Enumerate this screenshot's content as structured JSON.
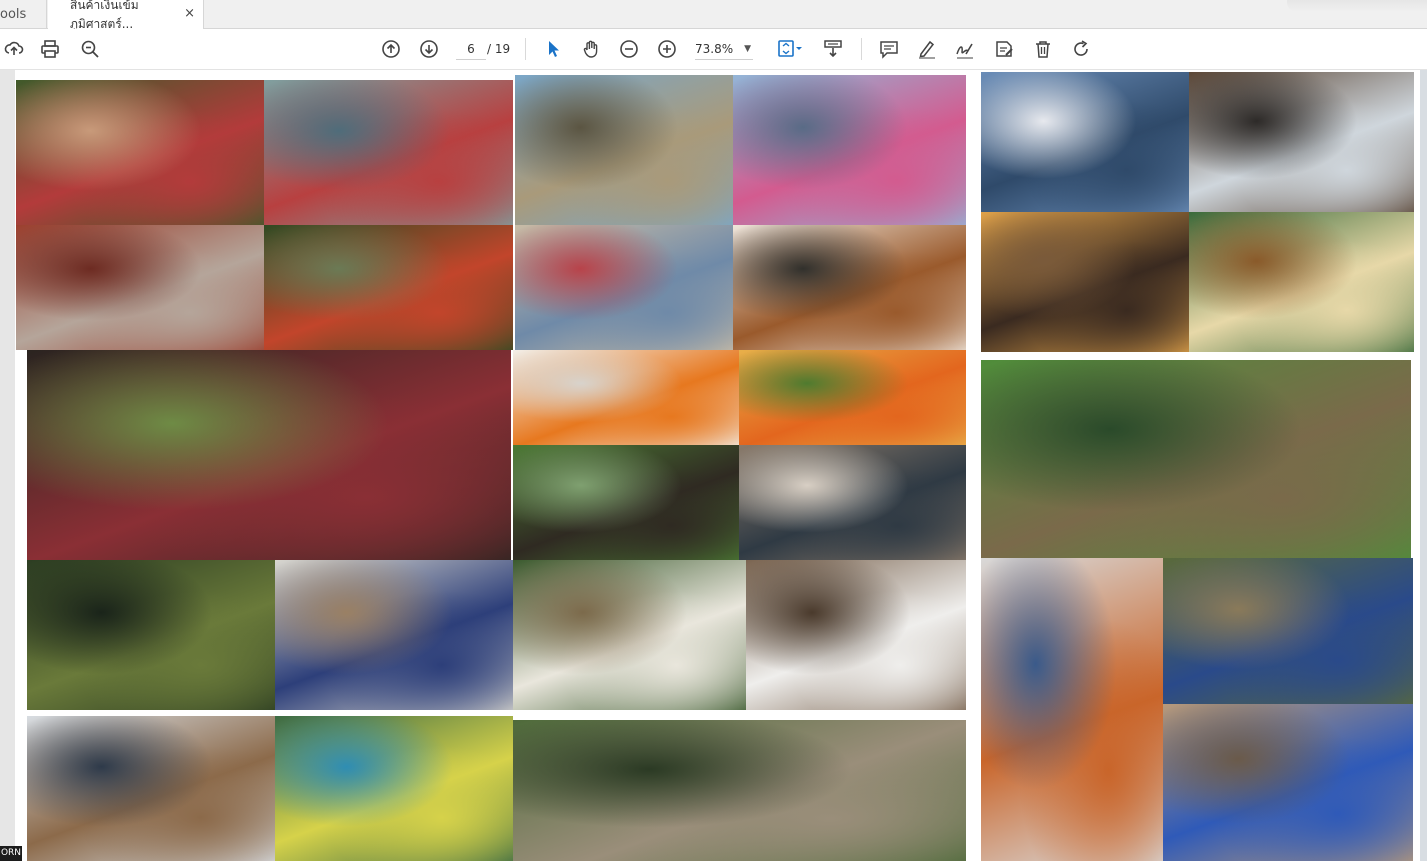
{
  "tabs": {
    "tools_label": "ools",
    "doc_label": "สินค้าเงินเข้ม ภูมิศาสตร์...",
    "close_glyph": "×"
  },
  "toolbar": {
    "page_current": "6",
    "page_total": "/ 19",
    "zoom": "73.8%",
    "icons": [
      "upload-icon",
      "print-icon",
      "zoom-search-icon",
      "page-up-icon",
      "page-down-icon",
      "select-pointer-icon",
      "hand-tool-icon",
      "zoom-out-icon",
      "zoom-in-icon",
      "fit-page-icon",
      "scroll-mode-icon",
      "comment-icon",
      "highlight-icon",
      "sign-icon",
      "edit-text-icon",
      "delete-icon",
      "rotate-icon"
    ]
  },
  "corner_label": "ORN",
  "colors": {
    "accent": "#1a73c8",
    "tabbar": "#f0f0f0"
  },
  "photos": [
    {
      "name": "photo-women-weaving-baskets",
      "colors": [
        "#3f5a2a",
        "#b33b3b",
        "#c89a7a"
      ]
    },
    {
      "name": "photo-weaving-workshop",
      "colors": [
        "#7fa0a0",
        "#b84040",
        "#4f6c7a"
      ]
    },
    {
      "name": "photo-shrimp-in-net",
      "colors": [
        "#9b3f2e",
        "#b5a59a",
        "#6d2b22"
      ]
    },
    {
      "name": "photo-boat-race-canal",
      "colors": [
        "#2f4a22",
        "#c2452b",
        "#6b7a55"
      ]
    },
    {
      "name": "photo-people-on-tidal-flat",
      "colors": [
        "#7aa7c9",
        "#a99a7a",
        "#5b5542"
      ]
    },
    {
      "name": "photo-two-women-sea",
      "colors": [
        "#93b6d8",
        "#d35b8f",
        "#596b86"
      ]
    },
    {
      "name": "photo-woman-digging-sand",
      "colors": [
        "#c9bca6",
        "#6f8aa8",
        "#b8434a"
      ]
    },
    {
      "name": "photo-seafood-salad-plate",
      "colors": [
        "#efe6dc",
        "#9a5a2c",
        "#31302c"
      ]
    },
    {
      "name": "photo-woman-loom",
      "colors": [
        "#2a2420",
        "#8a2f35",
        "#6e8b45"
      ]
    },
    {
      "name": "photo-salted-eggs",
      "colors": [
        "#f2efe9",
        "#e7781f",
        "#d8d3cc"
      ]
    },
    {
      "name": "photo-papaya-salad-eggs",
      "colors": [
        "#e8b04a",
        "#e3661e",
        "#4f7b2f"
      ]
    },
    {
      "name": "photo-duck-farm",
      "colors": [
        "#4c7a34",
        "#2f2a22",
        "#7fa070"
      ]
    },
    {
      "name": "photo-group-community",
      "colors": [
        "#8a7a6a",
        "#2f3a44",
        "#d8cfc4"
      ]
    },
    {
      "name": "photo-mangrove-tunnel",
      "colors": [
        "#2c3d22",
        "#6a7a3a",
        "#1a241a"
      ]
    },
    {
      "name": "photo-craft-workshop",
      "colors": [
        "#d9d7cf",
        "#2d3f7a",
        "#9a8064"
      ]
    },
    {
      "name": "photo-meditation-forest",
      "colors": [
        "#3b5a2e",
        "#e9e6dc",
        "#7c6a4b"
      ]
    },
    {
      "name": "photo-yoga-pavilion",
      "colors": [
        "#7a6450",
        "#efeeec",
        "#4a3a2c"
      ]
    },
    {
      "name": "photo-bottles-product",
      "colors": [
        "#d8dde2",
        "#8c6a4a",
        "#2e3a4a"
      ]
    },
    {
      "name": "photo-coconut-leaf-weaving",
      "colors": [
        "#3c6a44",
        "#d6d24a",
        "#2f8db3"
      ]
    },
    {
      "name": "photo-forest-path-stones",
      "colors": [
        "#4e6a3a",
        "#9a8e7a",
        "#2b3a24"
      ]
    },
    {
      "name": "photo-sea-pavilion",
      "colors": [
        "#6a8db8",
        "#2f4a6a",
        "#e7e9ee"
      ]
    },
    {
      "name": "photo-covered-pier",
      "colors": [
        "#5a4636",
        "#cfd6dc",
        "#2d2a28"
      ]
    },
    {
      "name": "photo-sunset-silhouette",
      "colors": [
        "#e0a24a",
        "#3a2a20",
        "#7a5a3a"
      ]
    },
    {
      "name": "photo-farm-shop-man",
      "colors": [
        "#3a6a3a",
        "#e7d8a8",
        "#8a5a2a"
      ]
    },
    {
      "name": "photo-muay-thai-boys",
      "colors": [
        "#4f8d3a",
        "#7a6a4a",
        "#2a4a2a"
      ]
    },
    {
      "name": "photo-boy-pointing-pier",
      "colors": [
        "#d9d9d9",
        "#c9652a",
        "#3a5a8a"
      ]
    },
    {
      "name": "photo-planting-mangrove",
      "colors": [
        "#5a6a3a",
        "#2a4a8a",
        "#8a7a5a"
      ]
    },
    {
      "name": "photo-boat-blue-baskets",
      "colors": [
        "#b89a7a",
        "#2f5ab8",
        "#6a5a4a"
      ]
    }
  ]
}
